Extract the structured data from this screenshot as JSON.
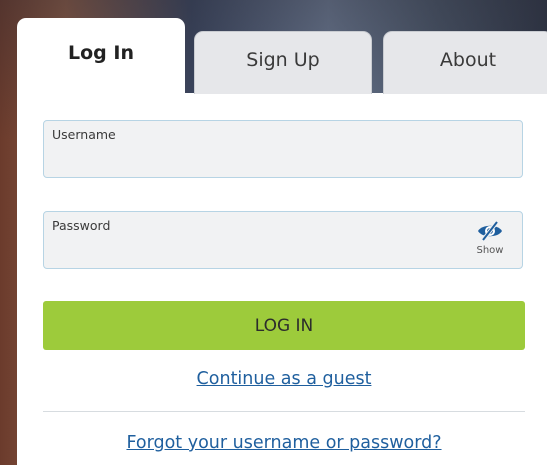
{
  "tabs": [
    {
      "label": "Log In",
      "active": true
    },
    {
      "label": "Sign Up",
      "active": false
    },
    {
      "label": "About",
      "active": false
    }
  ],
  "form": {
    "username": {
      "label": "Username",
      "value": ""
    },
    "password": {
      "label": "Password",
      "value": "",
      "show_label": "Show"
    },
    "login_button": "LOG IN",
    "guest_link": "Continue as a guest",
    "forgot_link": "Forgot your username or password?"
  },
  "colors": {
    "login_button": "#9dcb3b",
    "link": "#1f5f9e",
    "show_icon": "#1f5f9e"
  },
  "icons": {
    "show_password": "eye-slash-icon"
  }
}
